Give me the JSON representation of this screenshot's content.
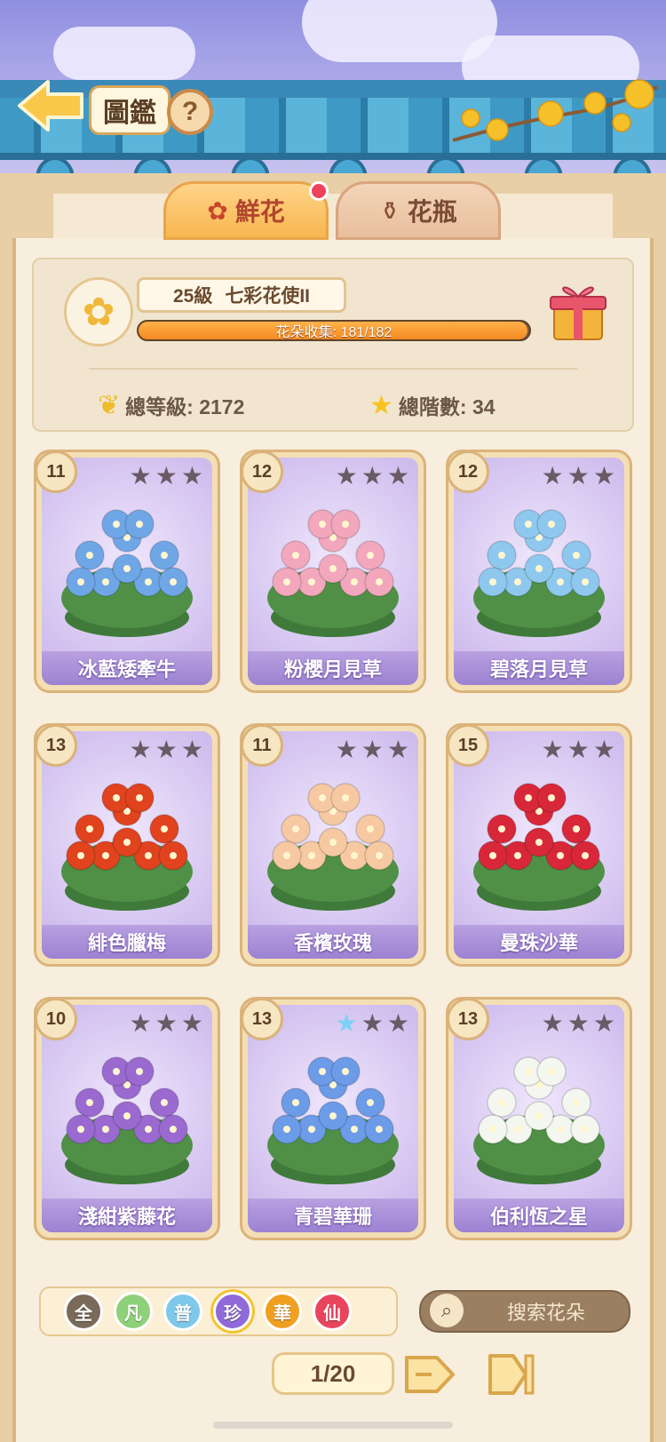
{
  "header": {
    "title": "圖鑑",
    "help_label": "?"
  },
  "tabs": [
    {
      "label": "鮮花",
      "active": true,
      "has_badge": true
    },
    {
      "label": "花瓶",
      "active": false
    }
  ],
  "profile": {
    "level_num": "25級",
    "rank_title": "七彩花使II",
    "collection_label": "花朵收集: 181/182",
    "collection_progress": 0.9945,
    "total_level_label": "總等級: 2172",
    "total_stage_label": "總階數: 34"
  },
  "cards": [
    {
      "level": "11",
      "name": "冰藍矮牽牛",
      "stars": [
        0,
        0,
        0
      ],
      "art": "blue-morning-glory-icon",
      "color": "#6fa6e6"
    },
    {
      "level": "12",
      "name": "粉櫻月見草",
      "stars": [
        0,
        0,
        0
      ],
      "art": "pink-primrose-icon",
      "color": "#f2a7bd"
    },
    {
      "level": "12",
      "name": "碧落月見草",
      "stars": [
        0,
        0,
        0
      ],
      "art": "blue-primrose-icon",
      "color": "#8ec8ee"
    },
    {
      "level": "13",
      "name": "緋色臘梅",
      "stars": [
        0,
        0,
        0
      ],
      "art": "red-plum-blossom-icon",
      "color": "#e0431e"
    },
    {
      "level": "11",
      "name": "香檳玫瑰",
      "stars": [
        0,
        0,
        0
      ],
      "art": "champagne-rose-icon",
      "color": "#f6c9a2"
    },
    {
      "level": "15",
      "name": "曼珠沙華",
      "stars": [
        0,
        0,
        0
      ],
      "art": "red-spider-lily-icon",
      "color": "#d9273a"
    },
    {
      "level": "10",
      "name": "淺紺紫藤花",
      "stars": [
        0,
        0,
        0
      ],
      "art": "wisteria-icon",
      "color": "#9a6ad1"
    },
    {
      "level": "13",
      "name": "青碧華珊",
      "stars": [
        1,
        0,
        0
      ],
      "art": "blue-coral-icon",
      "color": "#6c9be8"
    },
    {
      "level": "13",
      "name": "伯利恆之星",
      "stars": [
        0,
        0,
        0
      ],
      "art": "star-of-bethlehem-icon",
      "color": "#f4f7f0"
    }
  ],
  "filters": [
    {
      "label": "全",
      "color": "#7a6a5a",
      "selected": false
    },
    {
      "label": "凡",
      "color": "#8fd07a",
      "selected": false
    },
    {
      "label": "普",
      "color": "#7ec8ea",
      "selected": false
    },
    {
      "label": "珍",
      "color": "#8f6ad8",
      "selected": true
    },
    {
      "label": "華",
      "color": "#f0a020",
      "selected": false
    },
    {
      "label": "仙",
      "color": "#e9445e",
      "selected": false
    }
  ],
  "search": {
    "placeholder": "搜索花朵"
  },
  "pagination": {
    "label": "1/20"
  },
  "colors": {
    "accent": "#f48920",
    "card_bg": "#d9caf2",
    "frame": "#e8cfa5"
  }
}
